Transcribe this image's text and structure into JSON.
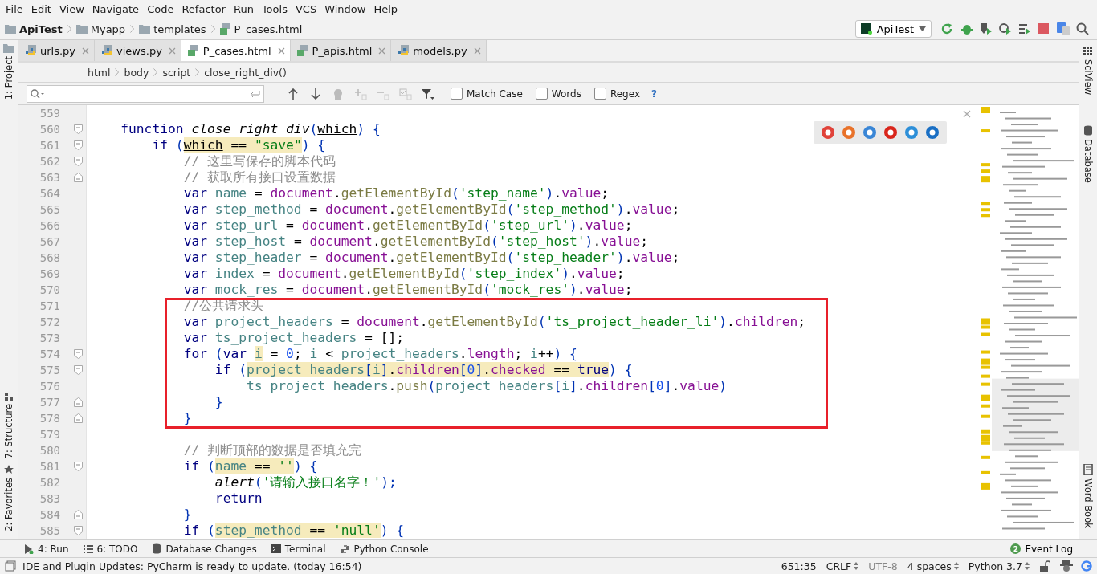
{
  "menu": [
    "File",
    "Edit",
    "View",
    "Navigate",
    "Code",
    "Refactor",
    "Run",
    "Tools",
    "VCS",
    "Window",
    "Help"
  ],
  "nav_path": [
    {
      "label": "ApiTest",
      "kind": "project"
    },
    {
      "label": "Myapp",
      "kind": "folder"
    },
    {
      "label": "templates",
      "kind": "folder"
    },
    {
      "label": "P_cases.html",
      "kind": "html"
    }
  ],
  "run_config": {
    "label": "ApiTest"
  },
  "tabs": [
    {
      "label": "urls.py",
      "kind": "python",
      "selected": false
    },
    {
      "label": "views.py",
      "kind": "python",
      "selected": false
    },
    {
      "label": "P_cases.html",
      "kind": "html",
      "selected": true
    },
    {
      "label": "P_apis.html",
      "kind": "html",
      "selected": false
    },
    {
      "label": "models.py",
      "kind": "python",
      "selected": false
    }
  ],
  "editor_breadcrumb": [
    "html",
    "body",
    "script",
    "close_right_div()"
  ],
  "find_bar": {
    "options": [
      {
        "label": "Match Case",
        "checked": false
      },
      {
        "label": "Words",
        "checked": false
      },
      {
        "label": "Regex",
        "checked": false
      }
    ],
    "help": "?"
  },
  "left_tools": [
    {
      "label": "1: Project",
      "kind": "folder"
    },
    {
      "label": "7: Structure",
      "kind": "structure"
    },
    {
      "label": "2: Favorites",
      "kind": "star"
    }
  ],
  "right_tools": [
    {
      "label": "SciView",
      "kind": "grid"
    },
    {
      "label": "Database",
      "kind": "db"
    },
    {
      "label": "Word Book",
      "kind": "book"
    }
  ],
  "code_lines": [
    {
      "number": "559",
      "kind": "plain"
    },
    {
      "number": "560",
      "kind": "foldstart",
      "tokens": [
        {
          "kind": "kw",
          "text": "    function"
        },
        {
          "kind": "fn",
          "text": " close_right_div"
        },
        {
          "kind": "p",
          "text": "("
        },
        {
          "kind": "param",
          "text": "which"
        },
        {
          "kind": "p",
          "text": ") {"
        }
      ]
    },
    {
      "number": "561",
      "kind": "foldstart",
      "tokens": [
        {
          "kind": "kw",
          "text": "        if"
        },
        {
          "kind": "p",
          "text": " ("
        },
        {
          "kind": "usage",
          "parts": [
            {
              "kind": "param",
              "text": "which"
            },
            {
              "kind": "plain",
              "text": " == "
            },
            {
              "kind": "str",
              "text": "\"save\""
            }
          ]
        },
        {
          "kind": "p",
          "text": ") {"
        }
      ]
    },
    {
      "number": "562",
      "kind": "foldstart",
      "tokens": [
        {
          "kind": "cmt",
          "text": "            // 这里写保存的脚本代码"
        }
      ]
    },
    {
      "number": "563",
      "kind": "foldend",
      "tokens": [
        {
          "kind": "cmt",
          "text": "            // 获取所有接口设置数据"
        }
      ]
    },
    {
      "number": "564",
      "kind": "plain",
      "tokens": [
        {
          "kind": "kw",
          "text": "            var"
        },
        {
          "kind": "id",
          "text": " name"
        },
        {
          "kind": "plain",
          "text": " = "
        },
        {
          "kind": "obj",
          "text": "document"
        },
        {
          "kind": "plain",
          "text": "."
        },
        {
          "kind": "meth",
          "text": "getElementById"
        },
        {
          "kind": "p",
          "text": "("
        },
        {
          "kind": "str",
          "text": "'step_name'"
        },
        {
          "kind": "p",
          "text": ")"
        },
        {
          "kind": "plain",
          "text": "."
        },
        {
          "kind": "prop",
          "text": "value"
        },
        {
          "kind": "plain",
          "text": ";"
        }
      ]
    },
    {
      "number": "565",
      "kind": "plain",
      "tokens": [
        {
          "kind": "kw",
          "text": "            var"
        },
        {
          "kind": "id",
          "text": " step_method"
        },
        {
          "kind": "plain",
          "text": " = "
        },
        {
          "kind": "obj",
          "text": "document"
        },
        {
          "kind": "plain",
          "text": "."
        },
        {
          "kind": "meth",
          "text": "getElementById"
        },
        {
          "kind": "p",
          "text": "("
        },
        {
          "kind": "str",
          "text": "'step_method'"
        },
        {
          "kind": "p",
          "text": ")"
        },
        {
          "kind": "plain",
          "text": "."
        },
        {
          "kind": "prop",
          "text": "value"
        },
        {
          "kind": "plain",
          "text": ";"
        }
      ]
    },
    {
      "number": "566",
      "kind": "plain",
      "tokens": [
        {
          "kind": "kw",
          "text": "            var"
        },
        {
          "kind": "id",
          "text": " step_url"
        },
        {
          "kind": "plain",
          "text": " = "
        },
        {
          "kind": "obj",
          "text": "document"
        },
        {
          "kind": "plain",
          "text": "."
        },
        {
          "kind": "meth",
          "text": "getElementById"
        },
        {
          "kind": "p",
          "text": "("
        },
        {
          "kind": "str",
          "text": "'step_url'"
        },
        {
          "kind": "p",
          "text": ")"
        },
        {
          "kind": "plain",
          "text": "."
        },
        {
          "kind": "prop",
          "text": "value"
        },
        {
          "kind": "plain",
          "text": ";"
        }
      ]
    },
    {
      "number": "567",
      "kind": "plain",
      "tokens": [
        {
          "kind": "kw",
          "text": "            var"
        },
        {
          "kind": "id",
          "text": " step_host"
        },
        {
          "kind": "plain",
          "text": " = "
        },
        {
          "kind": "obj",
          "text": "document"
        },
        {
          "kind": "plain",
          "text": "."
        },
        {
          "kind": "meth",
          "text": "getElementById"
        },
        {
          "kind": "p",
          "text": "("
        },
        {
          "kind": "str",
          "text": "'step_host'"
        },
        {
          "kind": "p",
          "text": ")"
        },
        {
          "kind": "plain",
          "text": "."
        },
        {
          "kind": "prop",
          "text": "value"
        },
        {
          "kind": "plain",
          "text": ";"
        }
      ]
    },
    {
      "number": "568",
      "kind": "plain",
      "tokens": [
        {
          "kind": "kw",
          "text": "            var"
        },
        {
          "kind": "id",
          "text": " step_header"
        },
        {
          "kind": "plain",
          "text": " = "
        },
        {
          "kind": "obj",
          "text": "document"
        },
        {
          "kind": "plain",
          "text": "."
        },
        {
          "kind": "meth",
          "text": "getElementById"
        },
        {
          "kind": "p",
          "text": "("
        },
        {
          "kind": "str",
          "text": "'step_header'"
        },
        {
          "kind": "p",
          "text": ")"
        },
        {
          "kind": "plain",
          "text": "."
        },
        {
          "kind": "prop",
          "text": "value"
        },
        {
          "kind": "plain",
          "text": ";"
        }
      ]
    },
    {
      "number": "569",
      "kind": "plain",
      "tokens": [
        {
          "kind": "kw",
          "text": "            var"
        },
        {
          "kind": "id",
          "text": " index"
        },
        {
          "kind": "plain",
          "text": " = "
        },
        {
          "kind": "obj",
          "text": "document"
        },
        {
          "kind": "plain",
          "text": "."
        },
        {
          "kind": "meth",
          "text": "getElementById"
        },
        {
          "kind": "p",
          "text": "("
        },
        {
          "kind": "str",
          "text": "'step_index'"
        },
        {
          "kind": "p",
          "text": ")"
        },
        {
          "kind": "plain",
          "text": "."
        },
        {
          "kind": "prop",
          "text": "value"
        },
        {
          "kind": "plain",
          "text": ";"
        }
      ]
    },
    {
      "number": "570",
      "kind": "plain",
      "tokens": [
        {
          "kind": "kw",
          "text": "            var"
        },
        {
          "kind": "id",
          "text": " mock_res"
        },
        {
          "kind": "plain",
          "text": " = "
        },
        {
          "kind": "obj",
          "text": "document"
        },
        {
          "kind": "plain",
          "text": "."
        },
        {
          "kind": "meth",
          "text": "getElementById"
        },
        {
          "kind": "p",
          "text": "("
        },
        {
          "kind": "str",
          "text": "'mock_res'"
        },
        {
          "kind": "p",
          "text": ")"
        },
        {
          "kind": "plain",
          "text": "."
        },
        {
          "kind": "prop",
          "text": "value"
        },
        {
          "kind": "plain",
          "text": ";"
        }
      ]
    },
    {
      "number": "571",
      "kind": "plain",
      "tokens": [
        {
          "kind": "cmt",
          "text": "            //公共请求头"
        }
      ]
    },
    {
      "number": "572",
      "kind": "plain",
      "tokens": [
        {
          "kind": "kw",
          "text": "            var"
        },
        {
          "kind": "id",
          "text": " project_headers"
        },
        {
          "kind": "plain",
          "text": " = "
        },
        {
          "kind": "obj",
          "text": "document"
        },
        {
          "kind": "plain",
          "text": "."
        },
        {
          "kind": "meth",
          "text": "getElementById"
        },
        {
          "kind": "p",
          "text": "("
        },
        {
          "kind": "str",
          "text": "'ts_project_header_li'"
        },
        {
          "kind": "p",
          "text": ")"
        },
        {
          "kind": "plain",
          "text": "."
        },
        {
          "kind": "prop",
          "text": "children"
        },
        {
          "kind": "plain",
          "text": ";"
        }
      ]
    },
    {
      "number": "573",
      "kind": "plain",
      "tokens": [
        {
          "kind": "kw",
          "text": "            var"
        },
        {
          "kind": "id",
          "text": " ts_project_headers"
        },
        {
          "kind": "plain",
          "text": " = [];"
        }
      ]
    },
    {
      "number": "574",
      "kind": "foldstart",
      "tokens": [
        {
          "kind": "kw",
          "text": "            for"
        },
        {
          "kind": "p",
          "text": " ("
        },
        {
          "kind": "kw",
          "text": "var "
        },
        {
          "kind": "usage",
          "parts": [
            {
              "kind": "id",
              "text": "i"
            }
          ]
        },
        {
          "kind": "plain",
          "text": " = "
        },
        {
          "kind": "num",
          "text": "0"
        },
        {
          "kind": "plain",
          "text": "; "
        },
        {
          "kind": "id",
          "text": "i"
        },
        {
          "kind": "plain",
          "text": " < "
        },
        {
          "kind": "id",
          "text": "project_headers"
        },
        {
          "kind": "plain",
          "text": "."
        },
        {
          "kind": "prop",
          "text": "length"
        },
        {
          "kind": "plain",
          "text": "; "
        },
        {
          "kind": "id",
          "text": "i"
        },
        {
          "kind": "plain",
          "text": "++"
        },
        {
          "kind": "p",
          "text": ") {"
        }
      ]
    },
    {
      "number": "575",
      "kind": "foldstart",
      "tokens": [
        {
          "kind": "kw",
          "text": "                if"
        },
        {
          "kind": "p",
          "text": " ("
        },
        {
          "kind": "usage",
          "parts": [
            {
              "kind": "id",
              "text": "project_headers"
            },
            {
              "kind": "p",
              "text": "["
            },
            {
              "kind": "id",
              "text": "i"
            },
            {
              "kind": "p",
              "text": "]"
            },
            {
              "kind": "plain",
              "text": "."
            },
            {
              "kind": "prop",
              "text": "children"
            },
            {
              "kind": "p",
              "text": "["
            },
            {
              "kind": "num",
              "text": "0"
            },
            {
              "kind": "p",
              "text": "]"
            },
            {
              "kind": "plain",
              "text": "."
            },
            {
              "kind": "prop",
              "text": "checked"
            },
            {
              "kind": "plain",
              "text": " == "
            },
            {
              "kind": "kw",
              "text": "true"
            }
          ]
        },
        {
          "kind": "p",
          "text": ") {"
        }
      ]
    },
    {
      "number": "576",
      "kind": "plain",
      "tokens": [
        {
          "kind": "id",
          "text": "                    ts_project_headers"
        },
        {
          "kind": "plain",
          "text": "."
        },
        {
          "kind": "meth",
          "text": "push"
        },
        {
          "kind": "p",
          "text": "("
        },
        {
          "kind": "id",
          "text": "project_headers"
        },
        {
          "kind": "p",
          "text": "["
        },
        {
          "kind": "id",
          "text": "i"
        },
        {
          "kind": "p",
          "text": "]"
        },
        {
          "kind": "plain",
          "text": "."
        },
        {
          "kind": "prop",
          "text": "children"
        },
        {
          "kind": "p",
          "text": "["
        },
        {
          "kind": "num",
          "text": "0"
        },
        {
          "kind": "p",
          "text": "]"
        },
        {
          "kind": "plain",
          "text": "."
        },
        {
          "kind": "prop",
          "text": "value"
        },
        {
          "kind": "p",
          "text": ")"
        }
      ]
    },
    {
      "number": "577",
      "kind": "foldend",
      "tokens": [
        {
          "kind": "p",
          "text": "                }"
        }
      ]
    },
    {
      "number": "578",
      "kind": "foldend",
      "tokens": [
        {
          "kind": "p",
          "text": "            }"
        }
      ]
    },
    {
      "number": "579",
      "kind": "plain"
    },
    {
      "number": "580",
      "kind": "plain",
      "tokens": [
        {
          "kind": "cmt",
          "text": "            // 判断顶部的数据是否填充完"
        }
      ]
    },
    {
      "number": "581",
      "kind": "foldstart",
      "tokens": [
        {
          "kind": "kw",
          "text": "            if"
        },
        {
          "kind": "p",
          "text": " ("
        },
        {
          "kind": "usage",
          "parts": [
            {
              "kind": "id",
              "text": "name"
            },
            {
              "kind": "plain",
              "text": " == "
            },
            {
              "kind": "str",
              "text": "''"
            }
          ]
        },
        {
          "kind": "p",
          "text": ") {"
        }
      ]
    },
    {
      "number": "582",
      "kind": "plain",
      "tokens": [
        {
          "kind": "fn",
          "text": "                alert"
        },
        {
          "kind": "p",
          "text": "("
        },
        {
          "kind": "str",
          "text": "'请输入接口名字！'"
        },
        {
          "kind": "p",
          "text": ");"
        }
      ]
    },
    {
      "number": "583",
      "kind": "plain",
      "tokens": [
        {
          "kind": "kw",
          "text": "                return"
        }
      ]
    },
    {
      "number": "584",
      "kind": "foldend",
      "tokens": [
        {
          "kind": "p",
          "text": "            }"
        }
      ]
    },
    {
      "number": "585",
      "kind": "foldstart",
      "tokens": [
        {
          "kind": "kw",
          "text": "            if"
        },
        {
          "kind": "p",
          "text": " ("
        },
        {
          "kind": "usage",
          "parts": [
            {
              "kind": "id",
              "text": "step_method"
            },
            {
              "kind": "plain",
              "text": " == "
            },
            {
              "kind": "str",
              "text": "'null'"
            }
          ]
        },
        {
          "kind": "p",
          "text": ") {"
        }
      ]
    }
  ],
  "bottom_tools": [
    {
      "label": "4: Run",
      "kind": "run"
    },
    {
      "label": "6: TODO",
      "kind": "list"
    },
    {
      "label": "Database Changes",
      "kind": "db"
    },
    {
      "label": "Terminal",
      "kind": "terminal"
    },
    {
      "label": "Python Console",
      "kind": "python"
    }
  ],
  "event_log": {
    "count": "2",
    "label": "Event Log"
  },
  "status": {
    "message": "IDE and Plugin Updates: PyCharm is ready to update. (today 16:54)",
    "items": [
      {
        "label": "651:35",
        "kind": "text"
      },
      {
        "label": "CRLF",
        "kind": "select"
      },
      {
        "label": "UTF-8",
        "kind": "muted"
      },
      {
        "label": "4 spaces",
        "kind": "select"
      },
      {
        "label": "Python 3.7",
        "kind": "select"
      }
    ]
  }
}
